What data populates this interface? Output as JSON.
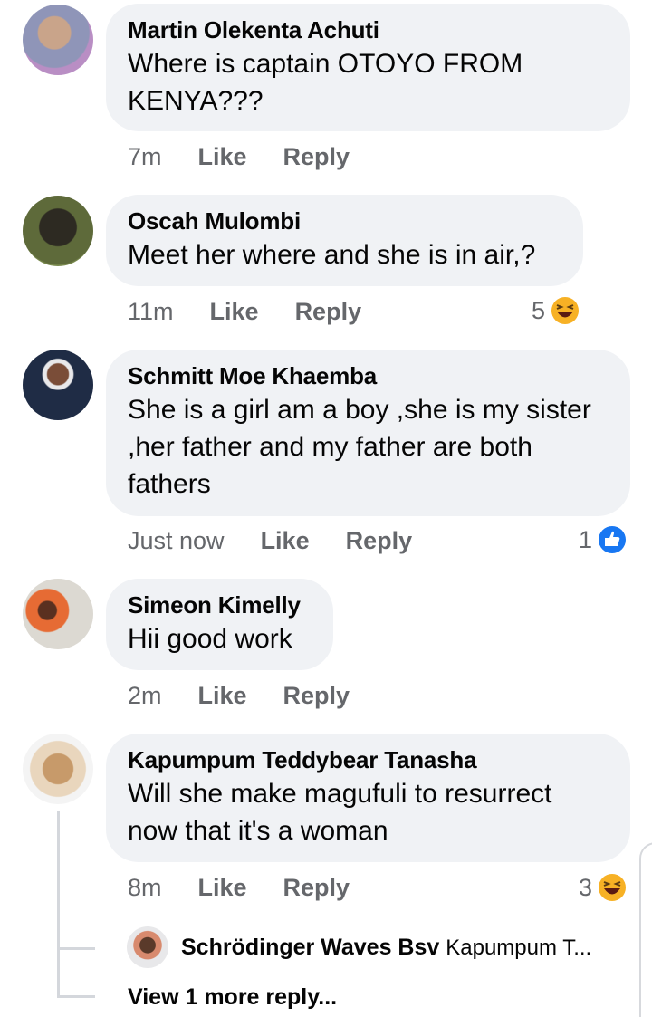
{
  "comments": [
    {
      "author": "Martin Olekenta Achuti",
      "text": "Where is captain OTOYO FROM KENYA???",
      "time": "7m",
      "like": "Like",
      "reply": "Reply",
      "reaction_count": ""
    },
    {
      "author": "Oscah Mulombi",
      "text": "Meet her where and she is in air,?",
      "time": "11m",
      "like": "Like",
      "reply": "Reply",
      "reaction_count": "5",
      "reaction_icon": "laugh-emoji-icon"
    },
    {
      "author": "Schmitt Moe Khaemba",
      "text": "She is a girl am a boy ,she is my sister ,her father and my father are both fathers",
      "time": "Just now",
      "like": "Like",
      "reply": "Reply",
      "reaction_count": "1",
      "reaction_icon": "like-thumb-icon"
    },
    {
      "author": "Simeon Kimelly",
      "text": "Hii good work",
      "time": "2m",
      "like": "Like",
      "reply": "Reply",
      "reaction_count": ""
    },
    {
      "author": "Kapumpum Teddybear Tanasha",
      "text": "Will she make magufuli to resurrect now that it's a woman",
      "time": "8m",
      "like": "Like",
      "reply": "Reply",
      "reaction_count": "3",
      "reaction_icon": "laugh-emoji-icon"
    }
  ],
  "reply_preview": {
    "author": "Schrödinger Waves Bsv",
    "snippet": "Kapumpum T..."
  },
  "view_more": "View 1 more reply...",
  "colors": {
    "bubble": "#f0f2f5",
    "meta": "#65676b",
    "like_blue": "#1877f2",
    "emoji_yellow": "#f7b125"
  }
}
